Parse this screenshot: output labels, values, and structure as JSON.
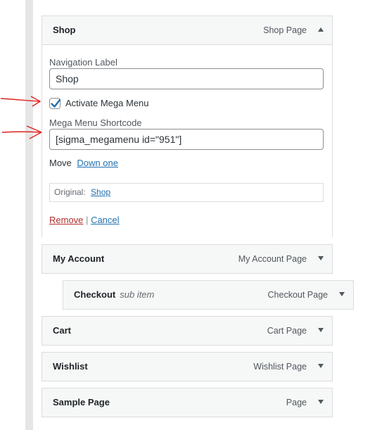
{
  "shop": {
    "title": "Shop",
    "type": "Shop Page",
    "nav_label_heading": "Navigation Label",
    "nav_label_value": "Shop",
    "activate_label": "Activate Mega Menu",
    "activate_checked": true,
    "shortcode_heading": "Mega Menu Shortcode",
    "shortcode_value": "[sigma_megamenu id=\"951\"]",
    "move_label": "Move",
    "move_link": "Down one",
    "original_label": "Original:",
    "original_link": "Shop",
    "remove_label": "Remove",
    "separator": "|",
    "cancel_label": "Cancel"
  },
  "items": [
    {
      "title": "My Account",
      "note": "",
      "type": "My Account Page"
    },
    {
      "title": "Checkout",
      "note": "sub item",
      "type": "Checkout Page"
    },
    {
      "title": "Cart",
      "note": "",
      "type": "Cart Page"
    },
    {
      "title": "Wishlist",
      "note": "",
      "type": "Wishlist Page"
    },
    {
      "title": "Sample Page",
      "note": "",
      "type": "Page"
    }
  ],
  "colors": {
    "annotation_arrow": "#e02020",
    "link": "#2271b1",
    "remove_link": "#b32d2e"
  }
}
